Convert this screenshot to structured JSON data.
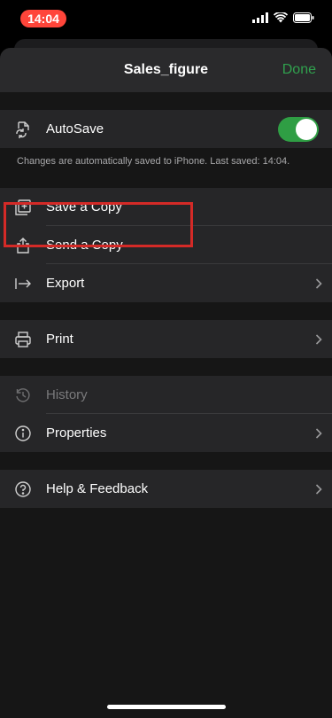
{
  "status_bar": {
    "time": "14:04"
  },
  "header": {
    "title": "Sales_figure",
    "done_label": "Done"
  },
  "autosave": {
    "label": "AutoSave",
    "enabled": true,
    "note": "Changes are automatically saved to iPhone. Last saved: 14:04."
  },
  "groups": {
    "save": [
      {
        "label": "Save a Copy",
        "icon": "save-copy-icon",
        "chevron": false
      },
      {
        "label": "Send a Copy",
        "icon": "share-icon",
        "chevron": false
      },
      {
        "label": "Export",
        "icon": "export-icon",
        "chevron": true
      }
    ],
    "print": [
      {
        "label": "Print",
        "icon": "printer-icon",
        "chevron": true
      }
    ],
    "info": [
      {
        "label": "History",
        "icon": "history-icon",
        "chevron": false,
        "disabled": true
      },
      {
        "label": "Properties",
        "icon": "info-icon",
        "chevron": true
      }
    ],
    "help": [
      {
        "label": "Help & Feedback",
        "icon": "help-icon",
        "chevron": true
      }
    ]
  },
  "colors": {
    "accent": "#30a14e",
    "highlight": "#d42a27",
    "time_pill": "#ff453a"
  }
}
